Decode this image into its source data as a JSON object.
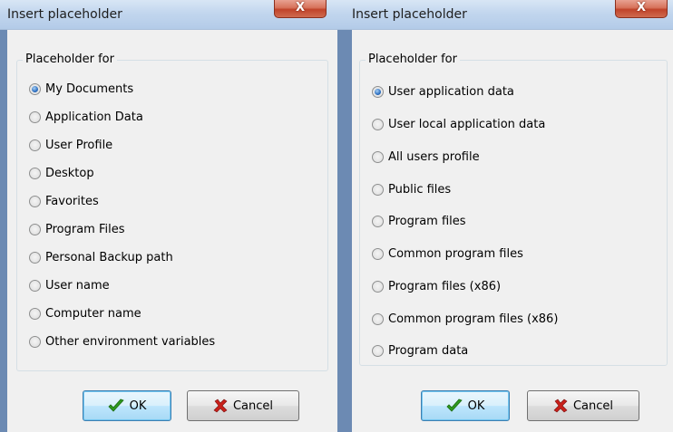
{
  "dialogs": [
    {
      "title": "Insert placeholder",
      "close_glyph": "X",
      "group_label": "Placeholder for",
      "options": [
        {
          "label": "My Documents",
          "checked": true
        },
        {
          "label": "Application Data",
          "checked": false
        },
        {
          "label": "User Profile",
          "checked": false
        },
        {
          "label": "Desktop",
          "checked": false
        },
        {
          "label": "Favorites",
          "checked": false
        },
        {
          "label": "Program Files",
          "checked": false
        },
        {
          "label": "Personal Backup path",
          "checked": false
        },
        {
          "label": "User name",
          "checked": false
        },
        {
          "label": "Computer name",
          "checked": false
        },
        {
          "label": "Other environment variables",
          "checked": false
        }
      ],
      "ok_label": "OK",
      "cancel_label": "Cancel"
    },
    {
      "title": "Insert placeholder",
      "close_glyph": "X",
      "group_label": "Placeholder for",
      "options": [
        {
          "label": "User application data",
          "checked": true
        },
        {
          "label": "User local application data",
          "checked": false
        },
        {
          "label": "All users profile",
          "checked": false
        },
        {
          "label": "Public files",
          "checked": false
        },
        {
          "label": "Program files",
          "checked": false
        },
        {
          "label": "Common program files",
          "checked": false
        },
        {
          "label": "Program files (x86)",
          "checked": false
        },
        {
          "label": "Common program files (x86)",
          "checked": false
        },
        {
          "label": "Program data",
          "checked": false
        }
      ],
      "ok_label": "OK",
      "cancel_label": "Cancel"
    }
  ],
  "icons": {
    "ok": "checkmark-icon",
    "cancel": "x-cross-icon",
    "close": "close-icon"
  },
  "colors": {
    "ok_check": "#2e9a1e",
    "cancel_x": "#c8201a",
    "close_button": "#c7452b",
    "radio_selected": "#2d6fc1"
  }
}
